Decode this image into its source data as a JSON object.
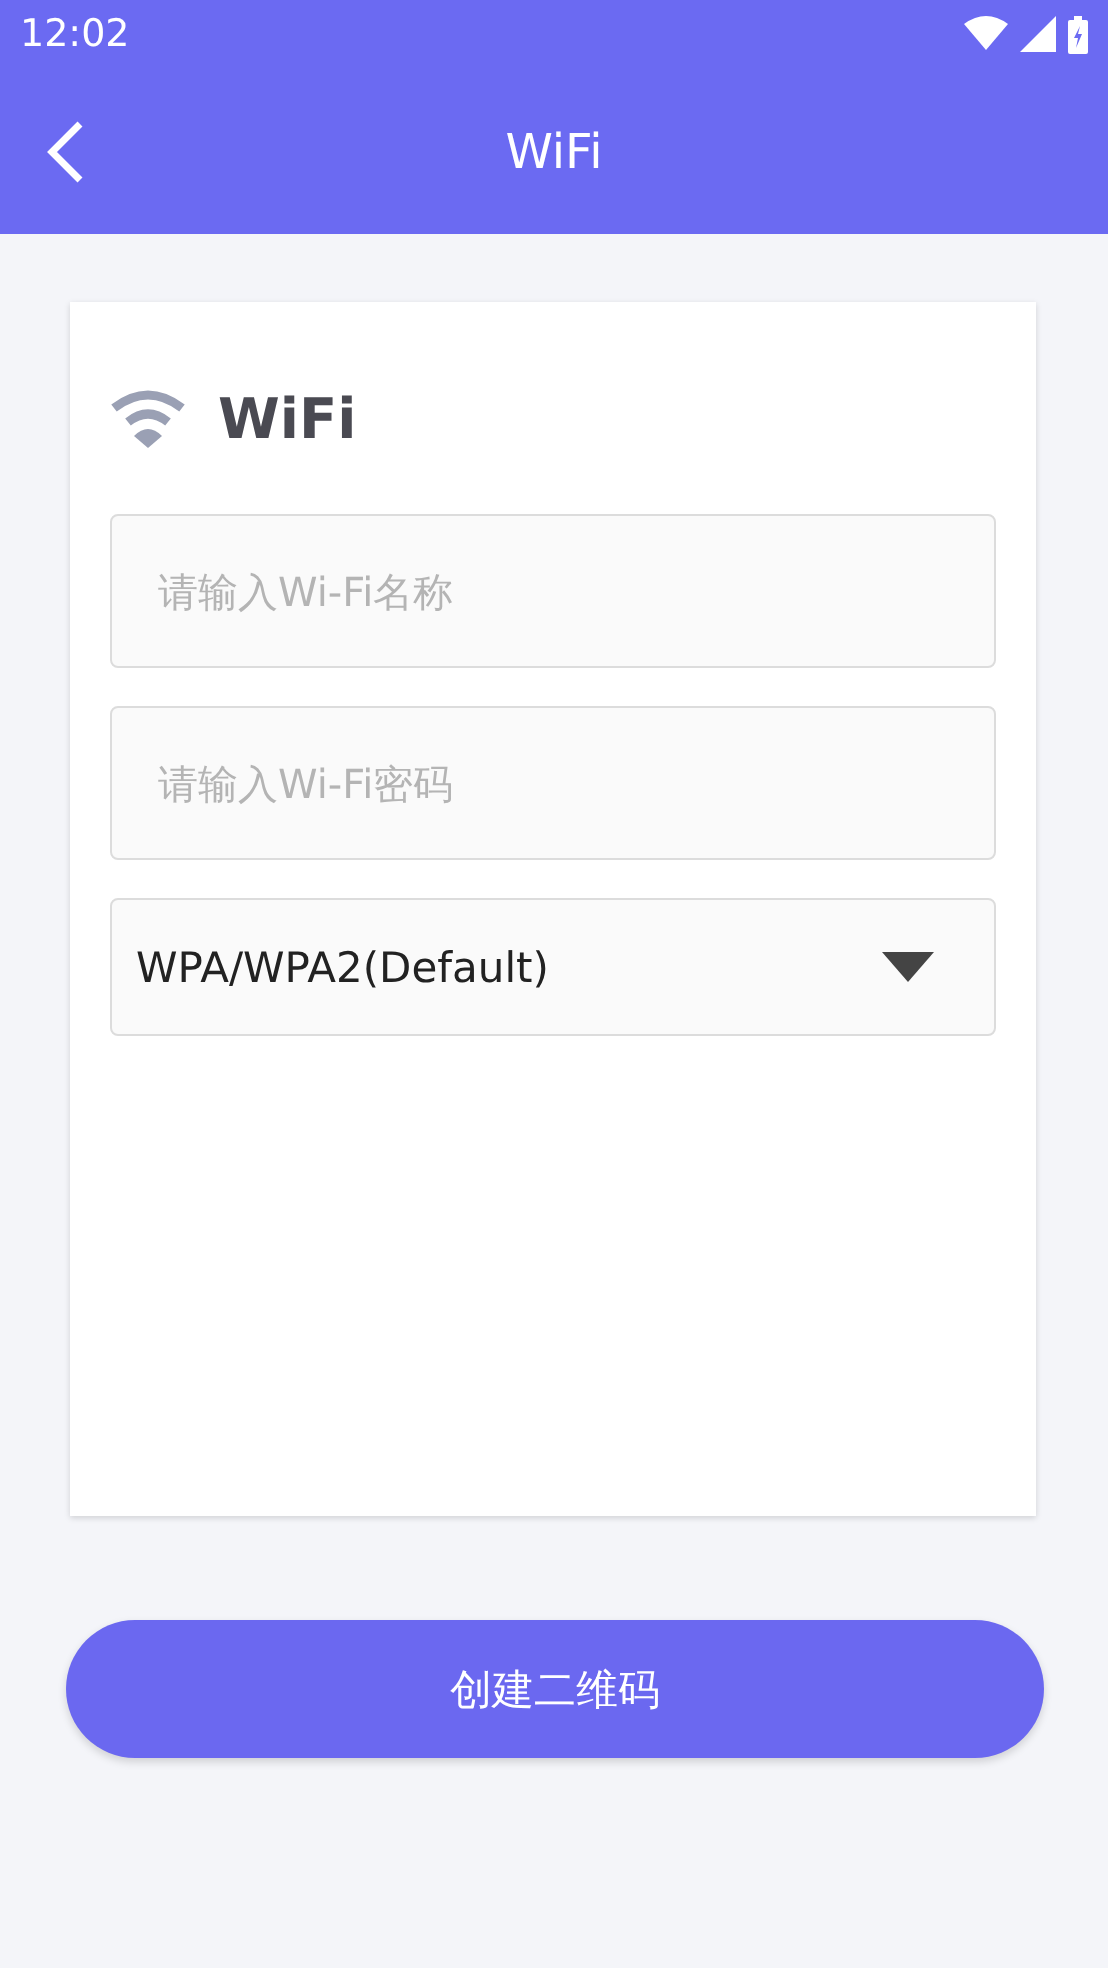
{
  "status_bar": {
    "time": "12:02"
  },
  "header": {
    "title": "WiFi"
  },
  "card": {
    "title": "WiFi",
    "fields": [
      {
        "placeholder": "请输入Wi-Fi名称"
      },
      {
        "placeholder": "请输入Wi-Fi密码"
      }
    ],
    "security": {
      "value": "WPA/WPA2(Default)"
    }
  },
  "button": {
    "label": "创建二维码"
  }
}
